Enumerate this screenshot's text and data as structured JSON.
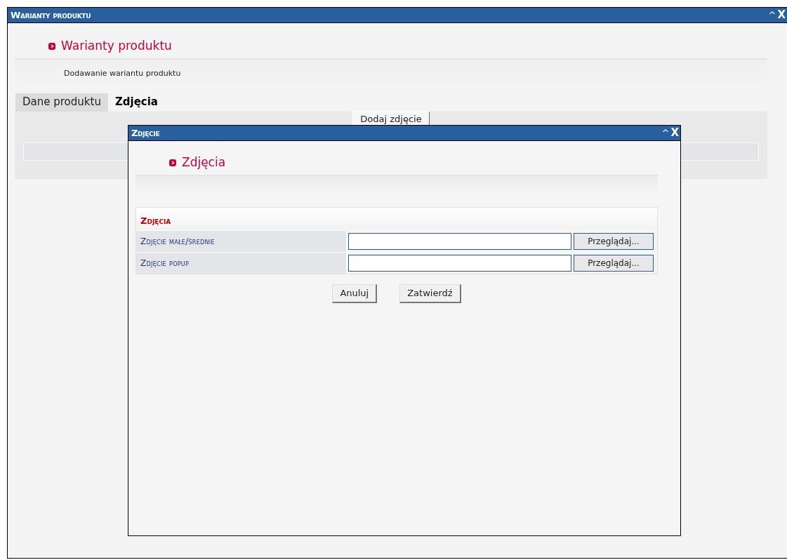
{
  "window": {
    "title": "Warianty produktu",
    "controls": [
      "^",
      "X"
    ]
  },
  "page": {
    "heading": "Warianty produktu",
    "subtitle": "Dodawanie wariantu produktu"
  },
  "tabs": [
    {
      "label": "Dane produktu",
      "selected": false
    },
    {
      "label": "Zdjęcia",
      "selected": true
    }
  ],
  "add_button": "Dodaj zdjęcie",
  "dialog": {
    "title": "Zdjęcie",
    "controls": [
      "^",
      "X"
    ],
    "heading": "Zdjęcia",
    "section": "Zdjęcia",
    "fields": [
      {
        "label": "Zdjęcie małe/średnie",
        "browse": "Przeglądaj..."
      },
      {
        "label": "Zdjęcie popup",
        "browse": "Przeglądaj..."
      }
    ],
    "buttons": [
      "Anuluj",
      "Zatwierdź"
    ]
  }
}
